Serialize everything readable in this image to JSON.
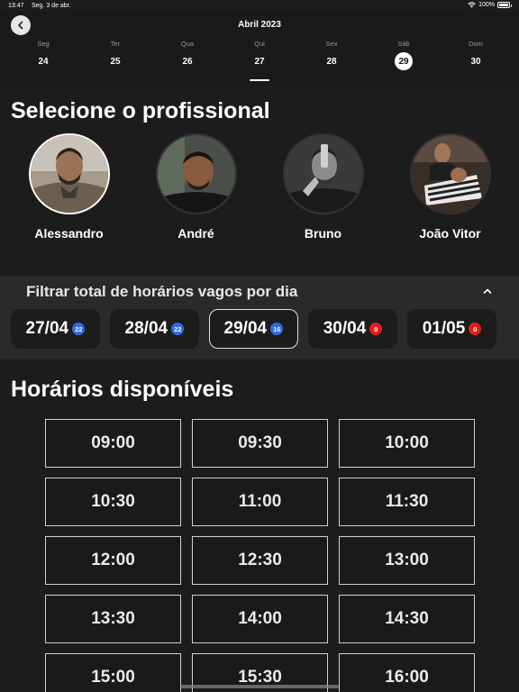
{
  "status_bar": {
    "time": "13:47",
    "date": "Seg. 3 de abr.",
    "battery": "100%"
  },
  "header": {
    "month": "Abril 2023",
    "days": [
      {
        "name": "Seg",
        "num": "24"
      },
      {
        "name": "Ter",
        "num": "25"
      },
      {
        "name": "Qua",
        "num": "26"
      },
      {
        "name": "Qui",
        "num": "27"
      },
      {
        "name": "Sex",
        "num": "28"
      },
      {
        "name": "Sáb",
        "num": "29"
      },
      {
        "name": "Dom",
        "num": "30"
      }
    ]
  },
  "professionals": {
    "title": "Selecione o profissional",
    "items": [
      {
        "name": "Alessandro"
      },
      {
        "name": "André"
      },
      {
        "name": "Bruno"
      },
      {
        "name": "João Vitor"
      }
    ]
  },
  "filter": {
    "title": "Filtrar total de horários vagos por dia",
    "chips": [
      {
        "date": "27/04",
        "count": "22",
        "badge_color": "#2f6be0"
      },
      {
        "date": "28/04",
        "count": "22",
        "badge_color": "#2f6be0"
      },
      {
        "date": "29/04",
        "count": "16",
        "badge_color": "#2f6be0"
      },
      {
        "date": "30/04",
        "count": "0",
        "badge_color": "#e01e1e"
      },
      {
        "date": "01/05",
        "count": "0",
        "badge_color": "#e01e1e"
      }
    ]
  },
  "times": {
    "title": "Horários disponíveis",
    "slots": [
      "09:00",
      "09:30",
      "10:00",
      "10:30",
      "11:00",
      "11:30",
      "12:00",
      "12:30",
      "13:00",
      "13:30",
      "14:00",
      "14:30",
      "15:00",
      "15:30",
      "16:00"
    ]
  },
  "icons": {
    "back": "chevron-left-icon",
    "collapse": "chevron-up-icon",
    "wifi": "wifi-icon",
    "battery": "battery-icon"
  }
}
